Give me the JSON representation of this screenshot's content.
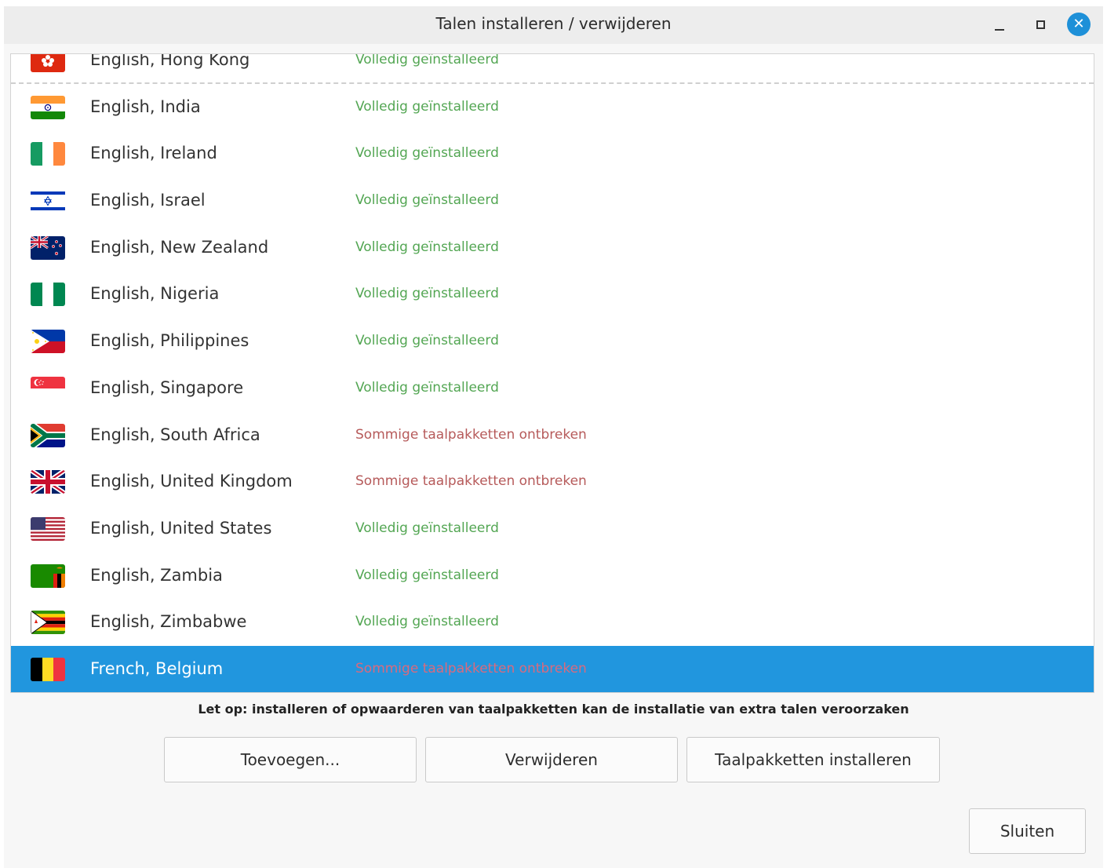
{
  "window": {
    "title": "Talen installeren / verwijderen",
    "close_glyph": "✕"
  },
  "languages": [
    {
      "name": "English, Hong Kong",
      "status": "Volledig geïnstalleerd",
      "status_type": "ok",
      "flag": "hong-kong-flag-icon"
    },
    {
      "name": "English, India",
      "status": "Volledig geïnstalleerd",
      "status_type": "ok",
      "flag": "india-flag-icon"
    },
    {
      "name": "English, Ireland",
      "status": "Volledig geïnstalleerd",
      "status_type": "ok",
      "flag": "ireland-flag-icon"
    },
    {
      "name": "English, Israel",
      "status": "Volledig geïnstalleerd",
      "status_type": "ok",
      "flag": "israel-flag-icon"
    },
    {
      "name": "English, New Zealand",
      "status": "Volledig geïnstalleerd",
      "status_type": "ok",
      "flag": "new-zealand-flag-icon"
    },
    {
      "name": "English, Nigeria",
      "status": "Volledig geïnstalleerd",
      "status_type": "ok",
      "flag": "nigeria-flag-icon"
    },
    {
      "name": "English, Philippines",
      "status": "Volledig geïnstalleerd",
      "status_type": "ok",
      "flag": "philippines-flag-icon"
    },
    {
      "name": "English, Singapore",
      "status": "Volledig geïnstalleerd",
      "status_type": "ok",
      "flag": "singapore-flag-icon"
    },
    {
      "name": "English, South Africa",
      "status": "Sommige taalpakketten ontbreken",
      "status_type": "missing",
      "flag": "south-africa-flag-icon"
    },
    {
      "name": "English, United Kingdom",
      "status": "Sommige taalpakketten ontbreken",
      "status_type": "missing",
      "flag": "united-kingdom-flag-icon"
    },
    {
      "name": "English, United States",
      "status": "Volledig geïnstalleerd",
      "status_type": "ok",
      "flag": "united-states-flag-icon"
    },
    {
      "name": "English, Zambia",
      "status": "Volledig geïnstalleerd",
      "status_type": "ok",
      "flag": "zambia-flag-icon"
    },
    {
      "name": "English, Zimbabwe",
      "status": "Volledig geïnstalleerd",
      "status_type": "ok",
      "flag": "zimbabwe-flag-icon"
    },
    {
      "name": "French, Belgium",
      "status": "Sommige taalpakketten ontbreken",
      "status_type": "missing",
      "flag": "belgium-flag-icon",
      "selected": true
    }
  ],
  "note": "Let op: installeren of opwaarderen van taalpakketten kan de installatie van extra talen veroorzaken",
  "buttons": {
    "add": "Toevoegen...",
    "remove": "Verwijderen",
    "install_packs": "Taalpakketten installeren",
    "close": "Sluiten"
  },
  "colors": {
    "selection": "#2196de",
    "status_ok": "#53a653",
    "status_missing": "#b65a5a",
    "close_button": "#1e90d8"
  }
}
